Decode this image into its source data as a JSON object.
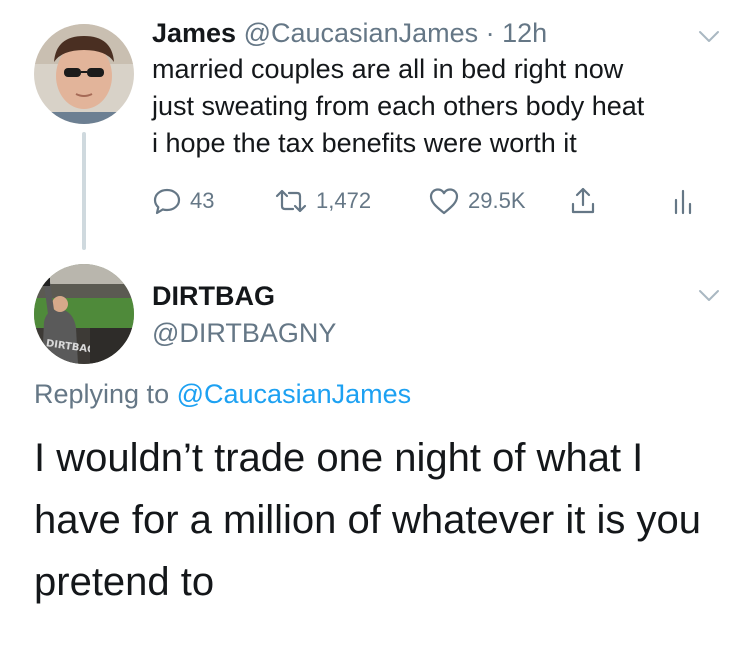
{
  "tweet": {
    "author_name": "James",
    "author_handle": "@CaucasianJames",
    "separator": "·",
    "time": "12h",
    "text_lines": [
      "married couples are all in bed right now",
      "just sweating from each others body heat",
      "i hope the tax benefits were worth it"
    ],
    "actions": {
      "reply_count": "43",
      "retweet_count": "1,472",
      "like_count": "29.5K"
    }
  },
  "reply": {
    "author_name": "DIRTBAG",
    "author_handle": "@DIRTBAGNY",
    "replying_prefix": "Replying to",
    "replying_to": "@CaucasianJames",
    "text_lines": [
      "I wouldn’t trade one night of what I",
      "have for a million of whatever it is you",
      "pretend to"
    ],
    "avatar_jersey_text": "DIRTBAG"
  },
  "colors": {
    "text_primary": "#14171a",
    "text_secondary": "#657786",
    "link": "#1da1f2",
    "thread_line": "#cfd9de"
  },
  "icons": {
    "reply": "reply-icon",
    "retweet": "retweet-icon",
    "like": "heart-icon",
    "share": "share-icon",
    "analytics": "analytics-icon",
    "menu": "chevron-down-icon"
  }
}
